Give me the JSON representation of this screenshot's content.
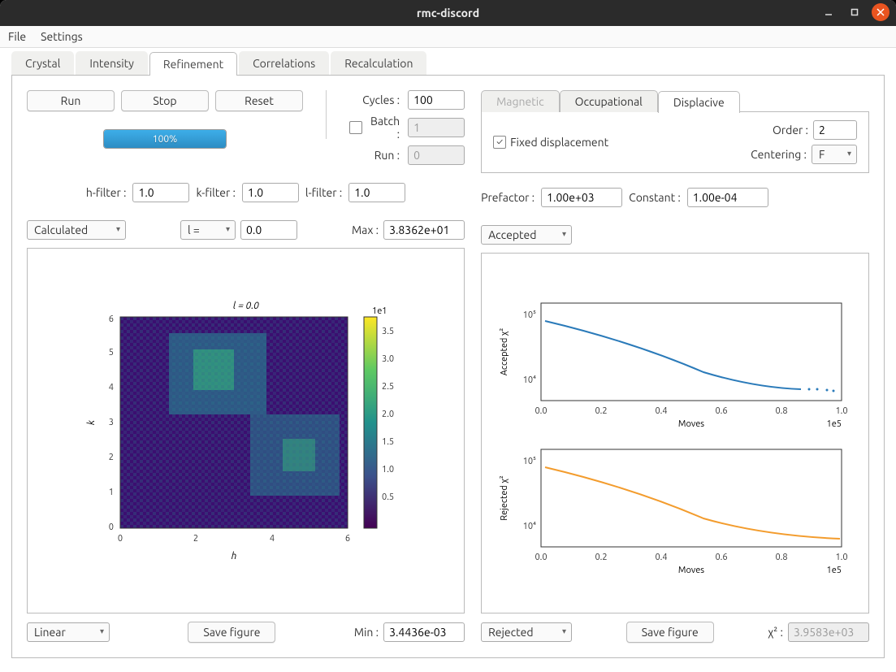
{
  "window": {
    "title": "rmc-discord"
  },
  "menu": {
    "file": "File",
    "settings": "Settings"
  },
  "tabs": {
    "crystal": "Crystal",
    "intensity": "Intensity",
    "refinement": "Refinement",
    "correlations": "Correlations",
    "recalculation": "Recalculation"
  },
  "refine": {
    "run": "Run",
    "stop": "Stop",
    "reset": "Reset",
    "progress": "100%",
    "cycles_lbl": "Cycles :",
    "cycles": "100",
    "batch_lbl": "Batch :",
    "batch": "1",
    "run_lbl": "Run :",
    "run_val": "0",
    "hfilter_lbl": "h-filter :",
    "hfilter": "1.0",
    "kfilter_lbl": "k-filter :",
    "kfilter": "1.0",
    "lfilter_lbl": "l-filter :",
    "lfilter": "1.0",
    "prefactor_lbl": "Prefactor :",
    "prefactor": "1.00e+03",
    "constant_lbl": "Constant :",
    "constant": "1.00e-04"
  },
  "disorder_tabs": {
    "magnetic": "Magnetic",
    "occupational": "Occupational",
    "displacive": "Displacive"
  },
  "displacive": {
    "fixed": "Fixed displacement",
    "order_lbl": "Order :",
    "order": "2",
    "centering_lbl": "Centering :",
    "centering": "F"
  },
  "left": {
    "type": "Calculated",
    "axis": "l =",
    "axis_val": "0.0",
    "max_lbl": "Max :",
    "max": "3.8362e+01",
    "scale": "Linear",
    "save": "Save figure",
    "min_lbl": "Min :",
    "min": "3.4436e-03",
    "plot_title": "l = 0.0",
    "xlabel": "h",
    "ylabel": "k",
    "cbar_label": "1e1"
  },
  "right": {
    "top_sel": "Accepted",
    "bot_sel": "Rejected",
    "save": "Save figure",
    "chi_lbl": "χ² :",
    "chi": "3.9583e+03",
    "accepted_ylabel": "Accepted χ²",
    "rejected_ylabel": "Rejected χ²",
    "xlabel": "Moves",
    "xscale": "1e5"
  },
  "chart_data": [
    {
      "type": "heatmap",
      "title": "l = 0.0",
      "xlabel": "h",
      "ylabel": "k",
      "xlim": [
        0,
        6
      ],
      "ylim": [
        0,
        6
      ],
      "colorbar": {
        "label": "1e1",
        "range": [
          0.3,
          3.8
        ]
      }
    },
    {
      "type": "scatter",
      "title": "Accepted χ²",
      "xlabel": "Moves",
      "ylabel": "Accepted χ²",
      "x_scale_factor": 100000.0,
      "y_scale": "log",
      "ylim": [
        10000.0,
        100000.0
      ],
      "xlim": [
        0,
        105000.0
      ],
      "approx_points": {
        "x": [
          0,
          10000,
          20000,
          30000,
          40000,
          50000,
          60000,
          70000,
          80000,
          90000,
          100000
        ],
        "y": [
          80000,
          60000,
          45000,
          30000,
          20000,
          12000,
          7000,
          5500,
          5000,
          4800,
          4700
        ]
      }
    },
    {
      "type": "scatter",
      "title": "Rejected χ²",
      "xlabel": "Moves",
      "ylabel": "Rejected χ²",
      "x_scale_factor": 100000.0,
      "y_scale": "log",
      "ylim": [
        10000.0,
        100000.0
      ],
      "xlim": [
        0,
        105000.0
      ],
      "approx_points": {
        "x": [
          0,
          10000,
          20000,
          30000,
          40000,
          50000,
          60000,
          70000,
          80000,
          90000,
          100000
        ],
        "y": [
          80000,
          60000,
          45000,
          30000,
          20000,
          12000,
          7000,
          5500,
          4800,
          4500,
          4300
        ]
      }
    }
  ]
}
